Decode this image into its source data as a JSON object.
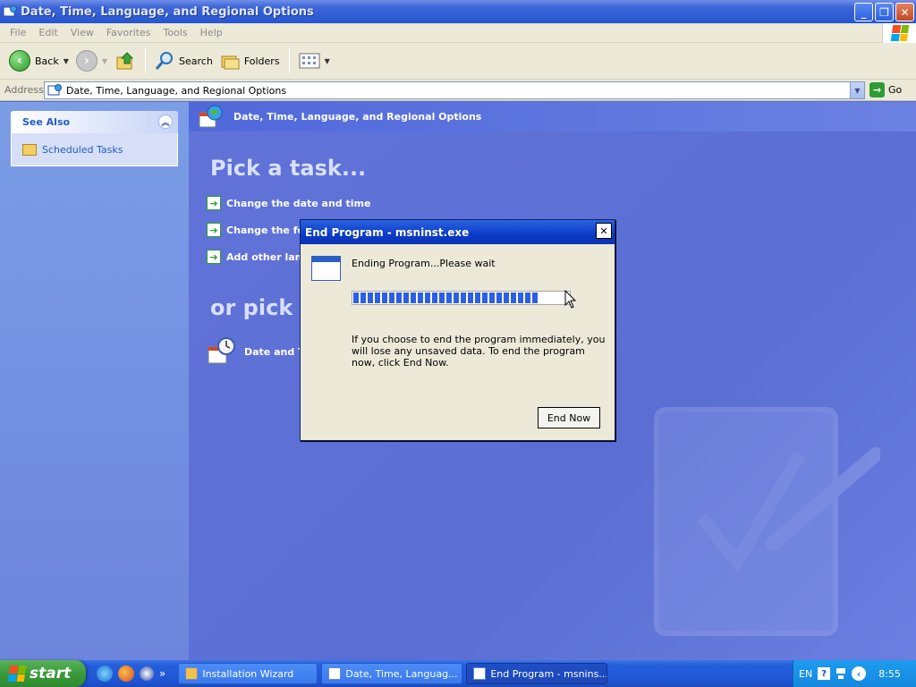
{
  "window": {
    "title": "Date, Time, Language, and Regional Options",
    "buttons": {
      "minimize": "_",
      "maximize": "❐",
      "close": "✕"
    }
  },
  "menubar": {
    "items": [
      "File",
      "Edit",
      "View",
      "Favorites",
      "Tools",
      "Help"
    ]
  },
  "toolbar": {
    "back_label": "Back",
    "search_label": "Search",
    "folders_label": "Folders"
  },
  "address": {
    "label": "Address",
    "value": "Date, Time, Language, and Regional Options",
    "go_label": "Go"
  },
  "sidebar": {
    "see_also_title": "See Also",
    "items": [
      {
        "label": "Scheduled Tasks"
      }
    ]
  },
  "main": {
    "header_title": "Date, Time, Language, and Regional Options",
    "pick_task": "Pick a task...",
    "tasks": [
      {
        "label": "Change the date and time"
      },
      {
        "label": "Change the for"
      },
      {
        "label": "Add other lang"
      }
    ],
    "or_pick": "or pick a",
    "icons": [
      {
        "label": "Date and Ti"
      }
    ]
  },
  "dialog": {
    "title": "End Program - msninst.exe",
    "close": "✕",
    "status": "Ending Program...Please wait",
    "progress_fraction": 0.85,
    "info": "If you choose to end the program immediately, you will lose any unsaved data. To end the program now, click End Now.",
    "end_now_label": "End Now"
  },
  "taskbar": {
    "start_label": "start",
    "more_label": "»",
    "tasks": [
      {
        "label": "Installation Wizard",
        "active": false
      },
      {
        "label": "Date, Time, Languag...",
        "active": false
      },
      {
        "label": "End Program - msnins...",
        "active": true
      }
    ],
    "tray": {
      "language": "EN",
      "help": "?",
      "time": "8:55"
    }
  },
  "colors": {
    "titlebar": "#2556d0",
    "content_bg": "#5a6ed3",
    "start_green": "#3b9a3b",
    "progress": "#2d5fe3"
  }
}
